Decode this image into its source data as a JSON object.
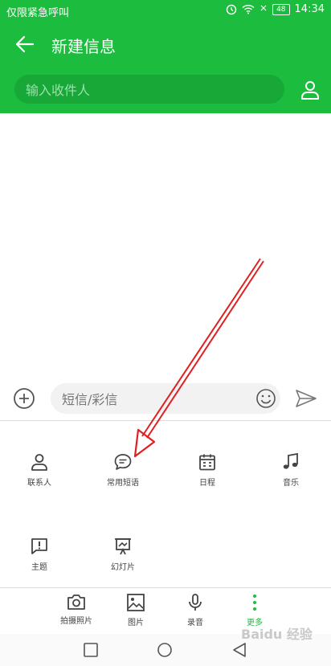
{
  "status_bar": {
    "carrier": "仅限紧急呼叫",
    "battery": "48",
    "time": "14:34"
  },
  "header": {
    "title": "新建信息",
    "recipient_placeholder": "输入收件人"
  },
  "composer": {
    "placeholder": "短信/彩信"
  },
  "more_panel": {
    "items": [
      {
        "label": "联系人",
        "icon": "contact-icon"
      },
      {
        "label": "常用短语",
        "icon": "chat-bubble-icon"
      },
      {
        "label": "日程",
        "icon": "calendar-icon"
      },
      {
        "label": "音乐",
        "icon": "music-note-icon"
      },
      {
        "label": "主题",
        "icon": "subject-icon"
      },
      {
        "label": "幻灯片",
        "icon": "slideshow-icon"
      }
    ]
  },
  "tabs": [
    {
      "label": "拍摄照片",
      "icon": "camera-icon"
    },
    {
      "label": "图片",
      "icon": "image-icon"
    },
    {
      "label": "录音",
      "icon": "microphone-icon"
    },
    {
      "label": "更多",
      "icon": "more-vertical-icon",
      "active": true
    }
  ],
  "watermark": "Baidu 经验",
  "colors": {
    "brand": "#1cbd3e",
    "arrow": "#e02020"
  }
}
